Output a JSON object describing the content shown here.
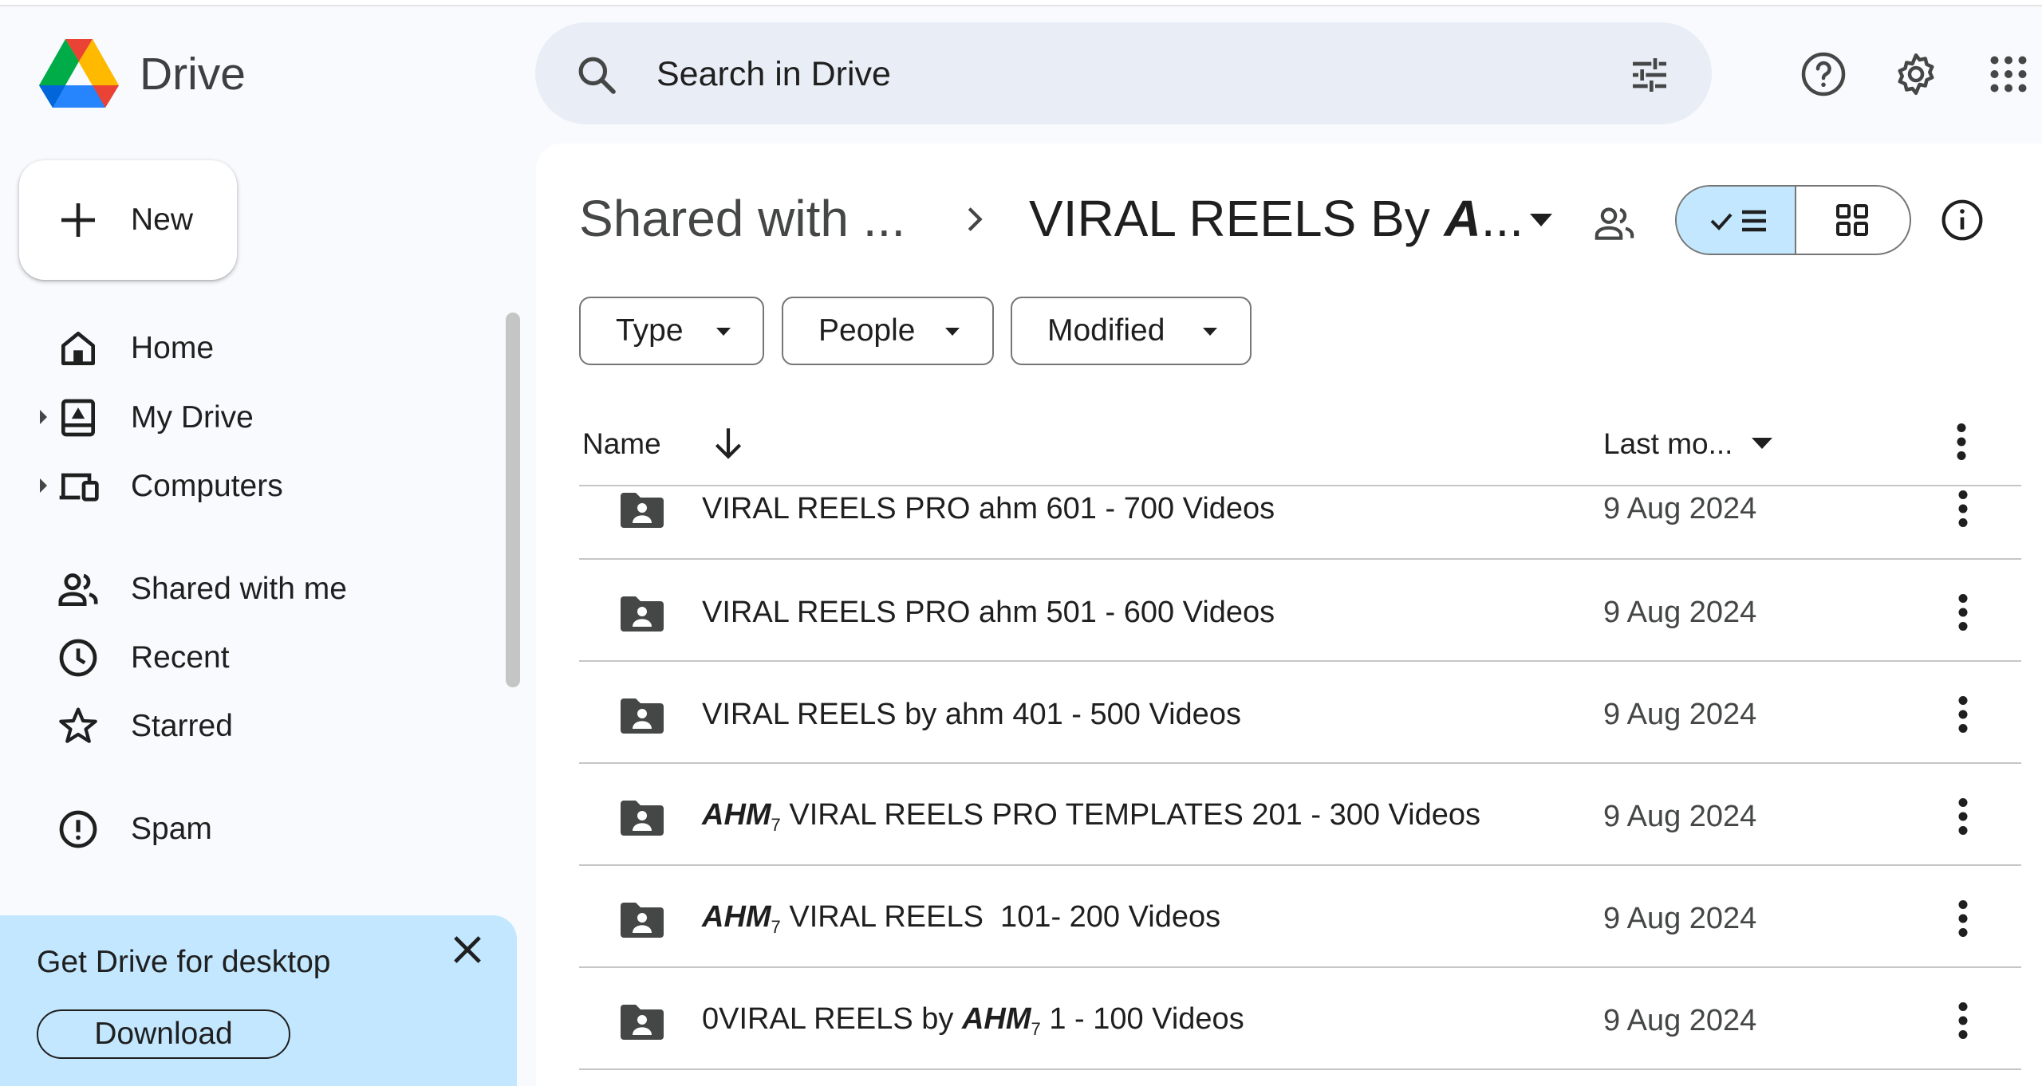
{
  "app": {
    "name": "Drive"
  },
  "search": {
    "placeholder": "Search in Drive"
  },
  "header_icons": [
    "help-icon",
    "settings-icon",
    "apps-grid-icon"
  ],
  "sidebar": {
    "new_label": "New",
    "items": [
      {
        "label": "Home",
        "icon": "home-icon",
        "expandable": false
      },
      {
        "label": "My Drive",
        "icon": "my-drive-icon",
        "expandable": true
      },
      {
        "label": "Computers",
        "icon": "computers-icon",
        "expandable": true
      },
      {
        "label": "Shared with me",
        "icon": "shared-people-icon",
        "expandable": false
      },
      {
        "label": "Recent",
        "icon": "clock-icon",
        "expandable": false
      },
      {
        "label": "Starred",
        "icon": "star-icon",
        "expandable": false
      },
      {
        "label": "Spam",
        "icon": "spam-icon",
        "expandable": false
      }
    ]
  },
  "promo": {
    "title": "Get Drive for desktop",
    "button": "Download"
  },
  "breadcrumb": {
    "parent": "Shared with ...",
    "current_prefix": "VIRAL REELS By ",
    "current_bold": "A",
    "current_suffix": "..."
  },
  "filters": [
    "Type",
    "People",
    "Modified"
  ],
  "table": {
    "col_name": "Name",
    "col_modified": "Last mo...",
    "rows": [
      {
        "prefix": "",
        "brand": "",
        "sub": "",
        "name": "VIRAL REELS PRO ahm 601 - 700 Videos",
        "suffix": "",
        "date": "9 Aug 2024"
      },
      {
        "prefix": "",
        "brand": "",
        "sub": "",
        "name": "VIRAL REELS PRO ahm 501 - 600 Videos",
        "suffix": "",
        "date": "9 Aug 2024"
      },
      {
        "prefix": "",
        "brand": "",
        "sub": "",
        "name": "VIRAL REELS by ahm 401 - 500 Videos",
        "suffix": "",
        "date": "9 Aug 2024"
      },
      {
        "prefix": "",
        "brand": "AHM",
        "sub": "7",
        "name": " VIRAL REELS PRO TEMPLATES 201 - 300 Videos",
        "suffix": "",
        "date": "9 Aug 2024"
      },
      {
        "prefix": "",
        "brand": "AHM",
        "sub": "7",
        "name": " VIRAL REELS  101- 200 Videos",
        "suffix": "",
        "date": "9 Aug 2024"
      },
      {
        "prefix": "0VIRAL REELS by ",
        "brand": "AHM",
        "sub": "7",
        "name": "",
        "suffix": " 1 - 100 Videos",
        "date": "9 Aug 2024"
      }
    ]
  },
  "colors": {
    "accent": "#c2e7ff",
    "surface": "#f8fafd",
    "search_bg": "#e9eef6"
  }
}
